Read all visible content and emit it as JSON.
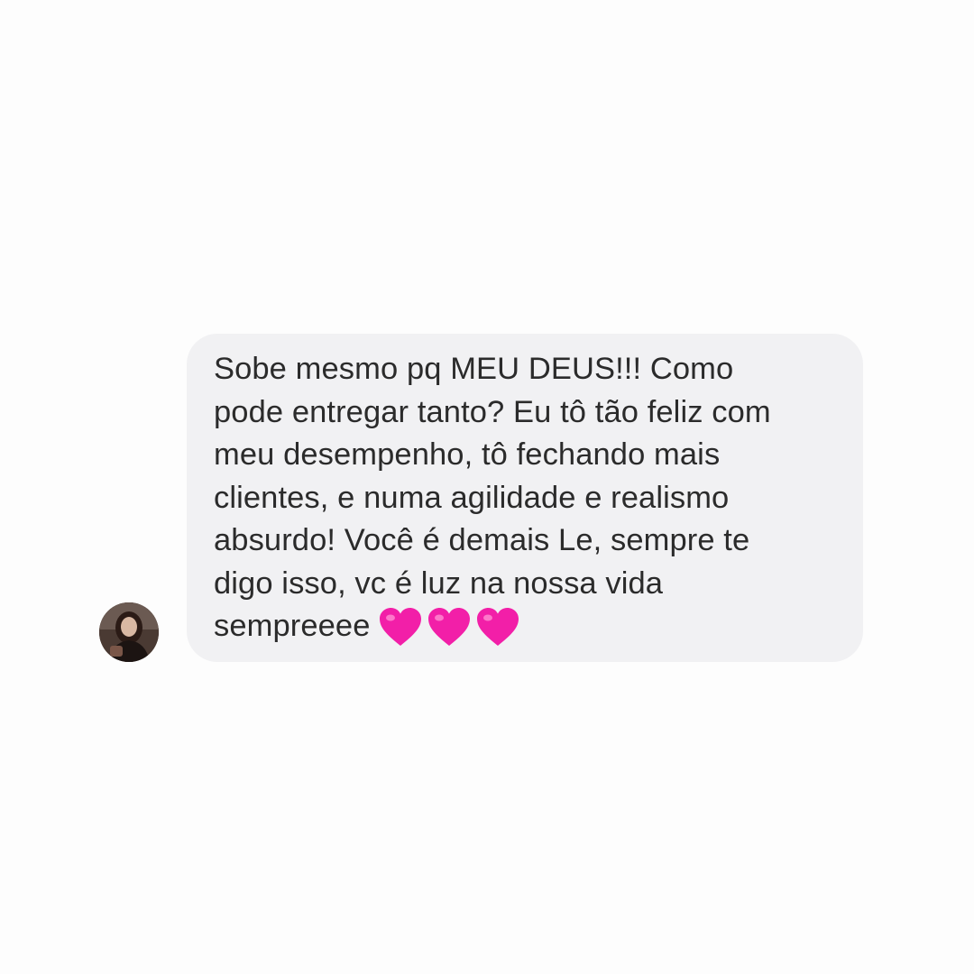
{
  "conversation": {
    "message": {
      "lines": [
        "Sobe mesmo pq MEU DEUS!!! Como",
        "pode entregar tanto? Eu tô tão feliz com",
        "meu desempenho, tô fechando mais",
        "clientes, e numa agilidade e realismo",
        "absurdo! Você é demais Le, sempre te",
        "digo isso, vc é luz na nossa vida",
        "sempreeee"
      ],
      "emoji": [
        "pink-heart-icon",
        "pink-heart-icon",
        "pink-heart-icon"
      ]
    },
    "sender_avatar": "avatar-photo"
  },
  "colors": {
    "background": "#fdfdfd",
    "bubble": "#f1f1f3",
    "text": "#2b2b2b",
    "heart": "#f21fa8"
  }
}
